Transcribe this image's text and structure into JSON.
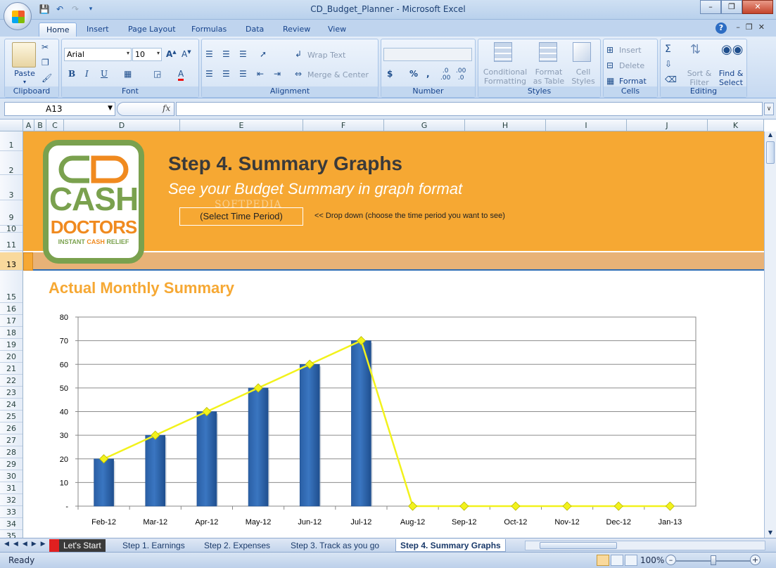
{
  "window": {
    "title": "CD_Budget_Planner - Microsoft Excel"
  },
  "ribbon_tabs": [
    {
      "label": "Home",
      "active": true
    },
    {
      "label": "Insert"
    },
    {
      "label": "Page Layout"
    },
    {
      "label": "Formulas"
    },
    {
      "label": "Data"
    },
    {
      "label": "Review"
    },
    {
      "label": "View"
    }
  ],
  "ribbon": {
    "clipboard": {
      "label": "Clipboard",
      "paste": "Paste"
    },
    "font": {
      "label": "Font",
      "name": "Arial",
      "size": "10"
    },
    "alignment": {
      "label": "Alignment",
      "wrap": "Wrap Text",
      "merge": "Merge & Center"
    },
    "number": {
      "label": "Number",
      "format": ""
    },
    "styles": {
      "label": "Styles",
      "conditional": "Conditional",
      "conditional2": "Formatting",
      "format_table": "Format",
      "format_table2": "as Table",
      "cell_styles": "Cell",
      "cell_styles2": "Styles"
    },
    "cells": {
      "label": "Cells",
      "insert": "Insert",
      "delete": "Delete",
      "format": "Format"
    },
    "editing": {
      "label": "Editing",
      "sort": "Sort &",
      "sort2": "Filter",
      "find": "Find &",
      "find2": "Select"
    }
  },
  "formula_bar": {
    "name_box": "A13",
    "fx": "fx",
    "value": ""
  },
  "columns": [
    "A",
    "B",
    "C",
    "D",
    "E",
    "F",
    "G",
    "H",
    "I",
    "J",
    "K"
  ],
  "rows": [
    "1",
    "2",
    "3",
    "9",
    "10",
    "11",
    "13",
    "15",
    "16",
    "17",
    "18",
    "19",
    "20",
    "21",
    "22",
    "23",
    "24",
    "25",
    "26",
    "27",
    "28",
    "29",
    "30",
    "31",
    "32",
    "33",
    "34",
    "35"
  ],
  "sheet": {
    "logo": {
      "cash": "CASH",
      "doctors": "DOCTORS",
      "tag_a": "INSTANT ",
      "tag_b": "CASH",
      "tag_c": " RELIEF"
    },
    "heading": "Step 4. Summary Graphs",
    "subheading": "See your Budget Summary in graph format",
    "dropdown_value": "(Select Time Period)",
    "dropdown_hint": "<< Drop down (choose the time period you want to see)",
    "chart_title": "Actual Monthly Summary"
  },
  "chart_data": {
    "type": "bar",
    "title": "Actual Monthly Summary",
    "categories": [
      "Feb-12",
      "Mar-12",
      "Apr-12",
      "May-12",
      "Jun-12",
      "Jul-12",
      "Aug-12",
      "Sep-12",
      "Oct-12",
      "Nov-12",
      "Dec-12",
      "Jan-13"
    ],
    "series": [
      {
        "type": "bar",
        "values": [
          20,
          30,
          40,
          50,
          60,
          70,
          0,
          0,
          0,
          0,
          0,
          0
        ]
      },
      {
        "type": "line",
        "values": [
          20,
          30,
          40,
          50,
          60,
          70,
          0,
          0,
          0,
          0,
          0,
          0
        ]
      }
    ],
    "y_ticks": [
      "-",
      "10",
      "20",
      "30",
      "40",
      "50",
      "60",
      "70",
      "80"
    ],
    "ylim": [
      0,
      80
    ],
    "grid": true,
    "colors": {
      "bar": "#3a76c1",
      "line": "#f2f21c",
      "marker": "#f2f21c"
    }
  },
  "sheet_tabs": [
    {
      "label": "Let's Start",
      "style": "red"
    },
    {
      "label": "Step 1. Earnings"
    },
    {
      "label": "Step 2. Expenses"
    },
    {
      "label": "Step 3. Track as you go"
    },
    {
      "label": "Step 4. Summary Graphs",
      "active": true
    }
  ],
  "status": {
    "text": "Ready",
    "zoom": "100%"
  }
}
